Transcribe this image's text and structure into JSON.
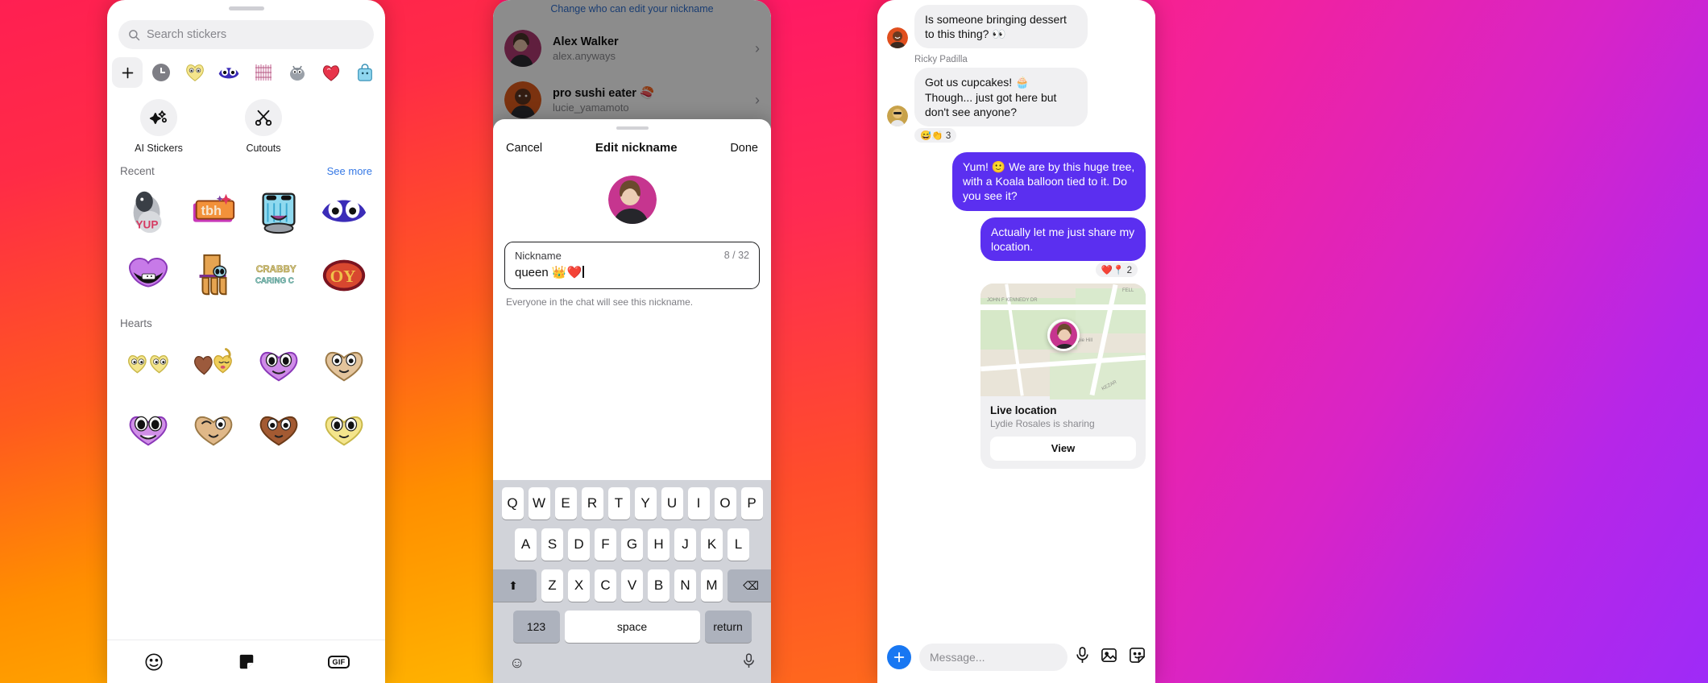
{
  "sticker_panel": {
    "search": {
      "placeholder": "Search stickers",
      "icon": "search-icon"
    },
    "categories": [
      {
        "name": "add-sticker",
        "glyph": "+"
      },
      {
        "name": "recent-clock",
        "glyph": ""
      },
      {
        "name": "yellow-heart-face-sticker",
        "glyph": ""
      },
      {
        "name": "purple-eyes-sticker",
        "glyph": ""
      },
      {
        "name": "pink-scribble-sticker",
        "glyph": ""
      },
      {
        "name": "grey-creature-sticker",
        "glyph": ""
      },
      {
        "name": "red-heart-sticker",
        "glyph": ""
      },
      {
        "name": "blue-bag-sticker",
        "glyph": ""
      }
    ],
    "tools": [
      {
        "label": "AI Stickers",
        "icon": "sparkle-icon"
      },
      {
        "label": "Cutouts",
        "icon": "scissors-icon"
      }
    ],
    "sections": [
      {
        "title": "Recent",
        "action": "See more"
      },
      {
        "title": "Hearts",
        "action": ""
      }
    ],
    "recent_stickers": [
      "pigeon-yup-sticker",
      "tbh-sticker",
      "crying-window-sticker",
      "purple-eyes-sticker",
      "purple-lips-sticker",
      "orange-legs-sticker",
      "crabby-caring-sticker",
      "oy-swirl-sticker"
    ],
    "heart_stickers": [
      "two-yellow-hearts",
      "brown-yellow-hearts",
      "purple-heart-face",
      "tan-heart-face",
      "purple-happy-heart",
      "brown-winking-heart",
      "dark-brown-heart",
      "yellow-heart-eyes"
    ],
    "tabs": [
      {
        "name": "emoji-tab",
        "label": ""
      },
      {
        "name": "sticker-tab",
        "label": ""
      },
      {
        "name": "gif-tab",
        "label": "GIF"
      }
    ]
  },
  "nickname_screen": {
    "background_note": "Change who can edit your nickname",
    "members": [
      {
        "name": "Alex Walker",
        "handle": "alex.anyways"
      },
      {
        "name": "pro sushi eater 🍣",
        "handle": "lucie_yamamoto"
      }
    ],
    "sheet": {
      "cancel": "Cancel",
      "title": "Edit nickname",
      "done": "Done",
      "field_label": "Nickname",
      "field_value": "queen 👑❤️",
      "counter": "8 / 32",
      "help": "Everyone in the chat will see this nickname."
    },
    "keyboard": {
      "row1": [
        "Q",
        "W",
        "E",
        "R",
        "T",
        "Y",
        "U",
        "I",
        "O",
        "P"
      ],
      "row2": [
        "A",
        "S",
        "D",
        "F",
        "G",
        "H",
        "J",
        "K",
        "L"
      ],
      "row3": [
        "Z",
        "X",
        "C",
        "V",
        "B",
        "N",
        "M"
      ],
      "shift": "⬆",
      "backspace": "⌫",
      "numbers": "123",
      "space": "space",
      "return": "return",
      "emoji_key": "emoji-icon",
      "mic_key": "microphone-icon"
    }
  },
  "chat_screen": {
    "messages": [
      {
        "type": "incoming",
        "text": "Is someone bringing dessert to this thing? 👀",
        "sender": "",
        "reactions": ""
      },
      {
        "type": "incoming",
        "text": "Got us cupcakes! 🧁 Though... just got here but don't see anyone?",
        "sender": "Ricky Padilla",
        "reactions": "😅👏 3"
      },
      {
        "type": "outgoing",
        "text": "Yum! 🙂 We are by this huge tree, with a Koala balloon tied to it. Do you see it?",
        "sender": "",
        "reactions": ""
      },
      {
        "type": "outgoing",
        "text": "Actually let me just share my location.",
        "sender": "",
        "reactions": "❤️📍 2"
      }
    ],
    "location_card": {
      "title": "Live location",
      "subtitle": "Lydie Rosales is sharing",
      "button": "View",
      "map_labels": [
        "JOHN F KENNEDY DR",
        "Hippie Hill",
        "FELL",
        "KEZAR"
      ]
    },
    "composer": {
      "placeholder": "Message...",
      "plus_icon": "plus-circle-icon",
      "icons": [
        "microphone-icon",
        "image-icon",
        "sticker-icon"
      ]
    }
  },
  "colors": {
    "accent_blue": "#1877f2",
    "bubble_out": "#5b2ff0",
    "bubble_in": "#f0f0f2",
    "link": "#3578e5"
  }
}
